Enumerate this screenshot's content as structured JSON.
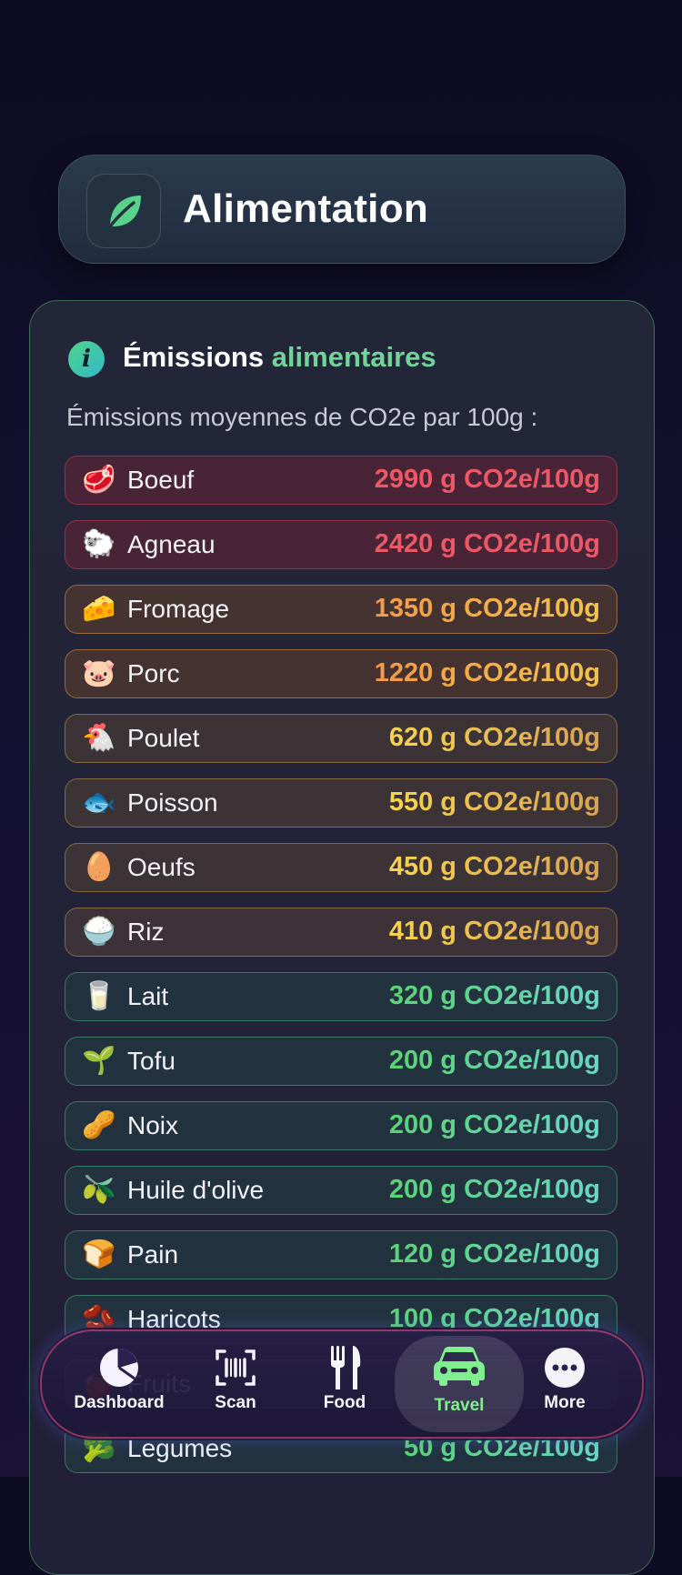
{
  "header": {
    "title": "Alimentation",
    "icon": "leaf-icon"
  },
  "panel": {
    "title_part1": "Émissions",
    "title_part2": "alimentaires",
    "subtitle": "Émissions moyennes de CO2e par 100g :",
    "items": [
      {
        "emoji": "🥩",
        "name": "Boeuf",
        "value": "2990 g CO2e/100g",
        "tier": "red"
      },
      {
        "emoji": "🐑",
        "name": "Agneau",
        "value": "2420 g CO2e/100g",
        "tier": "red"
      },
      {
        "emoji": "🧀",
        "name": "Fromage",
        "value": "1350 g CO2e/100g",
        "tier": "orange"
      },
      {
        "emoji": "🐷",
        "name": "Porc",
        "value": "1220 g CO2e/100g",
        "tier": "orange"
      },
      {
        "emoji": "🐔",
        "name": "Poulet",
        "value": "620 g CO2e/100g",
        "tier": "yellow"
      },
      {
        "emoji": "🐟",
        "name": "Poisson",
        "value": "550 g CO2e/100g",
        "tier": "yellow"
      },
      {
        "emoji": "🥚",
        "name": "Oeufs",
        "value": "450 g CO2e/100g",
        "tier": "yellow"
      },
      {
        "emoji": "🍚",
        "name": "Riz",
        "value": "410 g CO2e/100g",
        "tier": "yellow"
      },
      {
        "emoji": "🥛",
        "name": "Lait",
        "value": "320 g CO2e/100g",
        "tier": "green"
      },
      {
        "emoji": "🌱",
        "name": "Tofu",
        "value": "200 g CO2e/100g",
        "tier": "green"
      },
      {
        "emoji": "🥜",
        "name": "Noix",
        "value": "200 g CO2e/100g",
        "tier": "green"
      },
      {
        "emoji": "🫒",
        "name": "Huile d'olive",
        "value": "200 g CO2e/100g",
        "tier": "green"
      },
      {
        "emoji": "🍞",
        "name": "Pain",
        "value": "120 g CO2e/100g",
        "tier": "green"
      },
      {
        "emoji": "🫘",
        "name": "Haricots",
        "value": "100 g CO2e/100g",
        "tier": "green"
      },
      {
        "emoji": "🍎",
        "name": "Fruits",
        "value": "",
        "tier": "green"
      },
      {
        "emoji": "🥦",
        "name": "Legumes",
        "value": "50 g CO2e/100g",
        "tier": "green"
      }
    ]
  },
  "tabs": [
    {
      "label": "Dashboard",
      "icon": "pie-chart-icon",
      "active": false
    },
    {
      "label": "Scan",
      "icon": "barcode-scan-icon",
      "active": false
    },
    {
      "label": "Food",
      "icon": "fork-knife-icon",
      "active": false
    },
    {
      "label": "Travel",
      "icon": "car-icon",
      "active": true
    },
    {
      "label": "More",
      "icon": "ellipsis-icon",
      "active": false
    }
  ],
  "colors": {
    "red": "#ec5866",
    "orange": "#f39a4a",
    "yellow": "#f7d44f",
    "green": "#5cd275",
    "active_tab": "#7ff08d",
    "panel_border": "#50aa6e"
  }
}
